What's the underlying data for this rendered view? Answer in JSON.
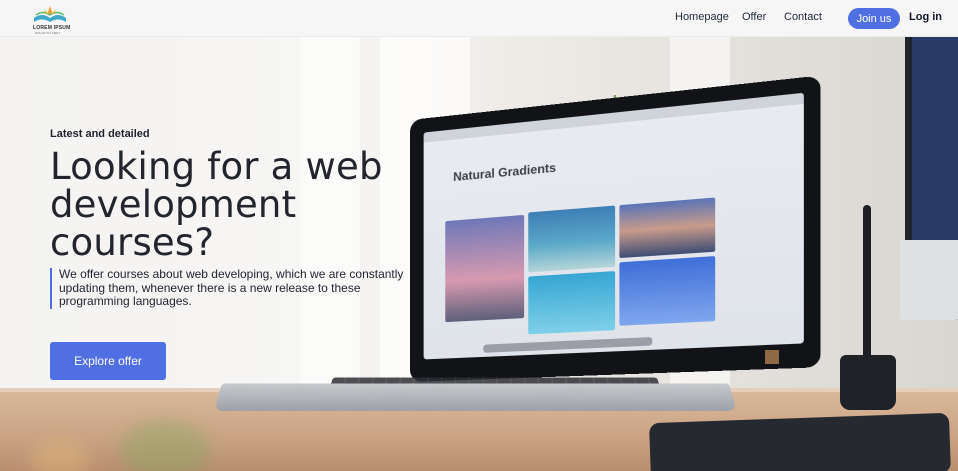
{
  "header": {
    "logo": {
      "title": "LOREM IPSUM",
      "tagline": "DOLOR SIT AMET"
    },
    "nav": [
      {
        "label": "Homepage"
      },
      {
        "label": "Offer"
      },
      {
        "label": "Contact"
      }
    ],
    "join_label": "Join us",
    "login_label": "Log in"
  },
  "hero": {
    "kicker": "Latest and detailed",
    "headline": "Looking for a web development courses?",
    "description": "We offer courses about web developing, which we are constantly updating them, whenever there is a new release to these programming languages.",
    "cta_label": "Explore offer",
    "laptop_screen_title": "Natural Gradients"
  },
  "colors": {
    "accent": "#4f6fe3",
    "text": "#22252d",
    "header_bg": "#f6f6f6"
  }
}
